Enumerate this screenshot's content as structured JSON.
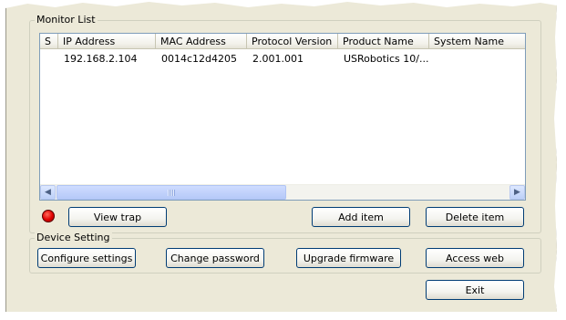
{
  "monitor_list": {
    "title": "Monitor List",
    "columns": [
      "S",
      "IP Address",
      "MAC Address",
      "Protocol Version",
      "Product Name",
      "System Name"
    ],
    "rows": [
      {
        "s": "",
        "ip": "192.168.2.104",
        "mac": "0014c12d4205",
        "protocol": "2.001.001",
        "product": "USRobotics 10/...",
        "system": ""
      }
    ],
    "status_led_color": "#e00000",
    "buttons": {
      "view_trap": "View trap",
      "add_item": "Add item",
      "delete_item": "Delete item"
    }
  },
  "device_setting": {
    "title": "Device Setting",
    "buttons": {
      "configure": "Configure settings",
      "change_password": "Change password",
      "upgrade_firmware": "Upgrade firmware",
      "access_web": "Access web"
    }
  },
  "exit_label": "Exit",
  "icons": {
    "scroll_left": "◀",
    "scroll_right": "▶"
  }
}
